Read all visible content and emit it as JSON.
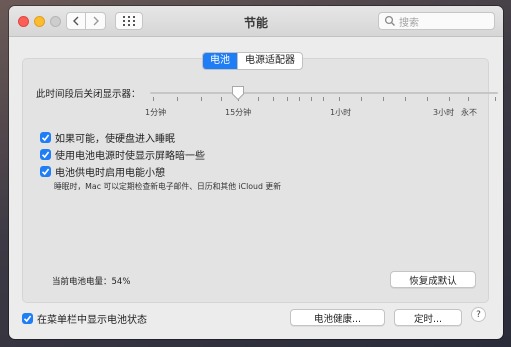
{
  "window": {
    "title": "节能"
  },
  "search": {
    "placeholder": "搜索"
  },
  "tabs": [
    {
      "label": "电池",
      "selected": true
    },
    {
      "label": "电源适配器",
      "selected": false
    }
  ],
  "display_sleep": {
    "label": "此时间段后关闭显示器：",
    "tick_labels": [
      "1分钟",
      "15分钟",
      "1小时",
      "3小时",
      "永不"
    ],
    "current_value": "15分钟"
  },
  "options": [
    {
      "label": "如果可能，使硬盘进入睡眠",
      "checked": true
    },
    {
      "label": "使用电池电源时使显示屏略暗一些",
      "checked": true
    },
    {
      "label": "电池供电时启用电能小憩",
      "checked": true
    }
  ],
  "power_nap_note": "睡眠时，Mac 可以定期检查新电子邮件、日历和其他 iCloud 更新",
  "battery_level": "当前电池电量：54%",
  "restore_defaults_label": "恢复成默认",
  "menu_bar_option": {
    "label": "在菜单栏中显示电池状态",
    "checked": true
  },
  "battery_health_label": "电池健康...",
  "schedule_label": "定时...",
  "help_label": "?",
  "colors": {
    "accent": "#1f7ef6",
    "window_bg": "#ececec"
  }
}
